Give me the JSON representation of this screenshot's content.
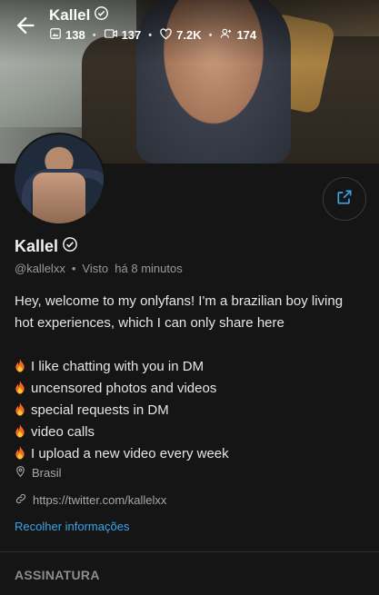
{
  "header": {
    "title": "Kallel",
    "stats": {
      "photos": "138",
      "videos": "137",
      "likes": "7.2K",
      "fans": "174"
    }
  },
  "profile": {
    "name": "Kallel",
    "username": "@kallelxx",
    "last_seen": "Visto  há 8 minutos",
    "bio_intro": [
      "Hey, welcome to my onlyfans! I'm a brazilian boy living",
      "hot experiences, which I can only share here"
    ],
    "bio_items": [
      "I like chatting with you in DM",
      "uncensored photos and videos",
      "special requests in DM",
      "video calls",
      "I upload a new video every week"
    ],
    "location": "Brasil",
    "website": "https://twitter.com/kallelxx",
    "collapse_label": "Recolher informações"
  },
  "section": {
    "title": "ASSINATURA"
  },
  "colors": {
    "accent": "#3aa6e8",
    "background": "#151515"
  },
  "icons": [
    "back-arrow-icon",
    "verified-icon",
    "photo-icon",
    "video-icon",
    "heart-icon",
    "fans-icon",
    "share-icon",
    "fire-icon",
    "location-icon",
    "link-icon"
  ]
}
